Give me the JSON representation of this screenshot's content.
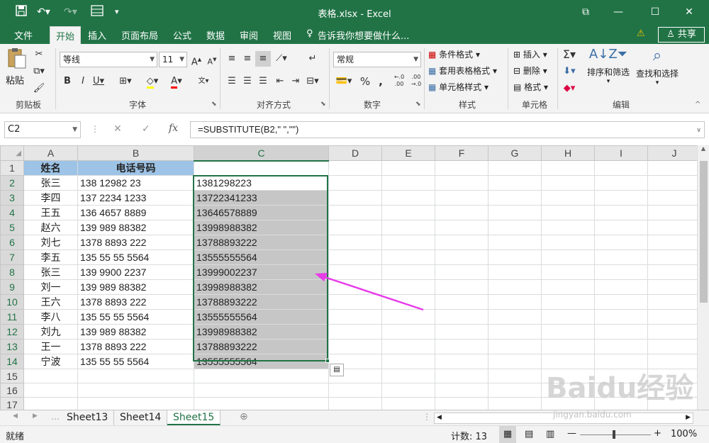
{
  "titlebar": {
    "title": "表格.xlsx - Excel"
  },
  "menubar": {
    "items": [
      "文件",
      "开始",
      "插入",
      "页面布局",
      "公式",
      "数据",
      "审阅",
      "视图"
    ],
    "tell_me": "告诉我你想要做什么...",
    "share": "共享"
  },
  "ribbon": {
    "clipboard": {
      "paste": "粘贴",
      "label": "剪贴板"
    },
    "font": {
      "name": "等线",
      "size": "11",
      "label": "字体"
    },
    "alignment": {
      "label": "对齐方式"
    },
    "number": {
      "format": "常规",
      "label": "数字",
      "percent": "%",
      "comma": ","
    },
    "styles": {
      "conditional": "条件格式",
      "table": "套用表格格式",
      "cell": "单元格样式",
      "label": "样式"
    },
    "cells": {
      "insert": "插入",
      "delete": "删除",
      "format": "格式",
      "label": "单元格"
    },
    "editing": {
      "sort": "排序和筛选",
      "find": "查找和选择",
      "label": "编辑"
    }
  },
  "formula_bar": {
    "name_box": "C2",
    "formula": "=SUBSTITUTE(B2,\" \",\"\")"
  },
  "columns": [
    "A",
    "B",
    "C",
    "D",
    "E",
    "F",
    "G",
    "H",
    "I",
    "J"
  ],
  "rows": [
    {
      "num": "1",
      "a": "姓名",
      "b": "电话号码",
      "c": ""
    },
    {
      "num": "2",
      "a": "张三",
      "b": "138  12982 23",
      "c": "1381298223"
    },
    {
      "num": "3",
      "a": "李四",
      "b": "137 2234  1233",
      "c": "13722341233"
    },
    {
      "num": "4",
      "a": "王五",
      "b": "136 4657 8889",
      "c": "13646578889"
    },
    {
      "num": "5",
      "a": "赵六",
      "b": "139 989 88382",
      "c": "13998988382"
    },
    {
      "num": "6",
      "a": "刘七",
      "b": "1378   8893 222",
      "c": "13788893222"
    },
    {
      "num": "7",
      "a": "李五",
      "b": "135 55 55  5564",
      "c": "13555555564"
    },
    {
      "num": "8",
      "a": "张三",
      "b": "139   9900  2237",
      "c": "13999002237"
    },
    {
      "num": "9",
      "a": "刘一",
      "b": "139 989 88382",
      "c": "13998988382"
    },
    {
      "num": "10",
      "a": "王六",
      "b": "1378   8893 222",
      "c": "13788893222"
    },
    {
      "num": "11",
      "a": "李八",
      "b": "135 55 55  5564",
      "c": "13555555564"
    },
    {
      "num": "12",
      "a": "刘九",
      "b": "139 989 88382",
      "c": "13998988382"
    },
    {
      "num": "13",
      "a": "王一",
      "b": "1378   8893 222",
      "c": "13788893222"
    },
    {
      "num": "14",
      "a": "宁波",
      "b": "135 55 55  5564",
      "c": "13555555564"
    },
    {
      "num": "15",
      "a": "",
      "b": "",
      "c": ""
    },
    {
      "num": "16",
      "a": "",
      "b": "",
      "c": ""
    },
    {
      "num": "17",
      "a": "",
      "b": "",
      "c": ""
    }
  ],
  "sheet_tabs": [
    "Sheet13",
    "Sheet14",
    "Sheet15"
  ],
  "active_tab": "Sheet15",
  "status": {
    "ready": "就绪",
    "count": "计数: 13",
    "zoom": "100%"
  },
  "watermark": {
    "text": "Baidu经验",
    "sub": "jingyan.baidu.com"
  },
  "colors": {
    "excel_green": "#217346",
    "header_fill": "#9dc3e6",
    "selection": "#c6c6c6",
    "arrow": "#e83be8"
  }
}
